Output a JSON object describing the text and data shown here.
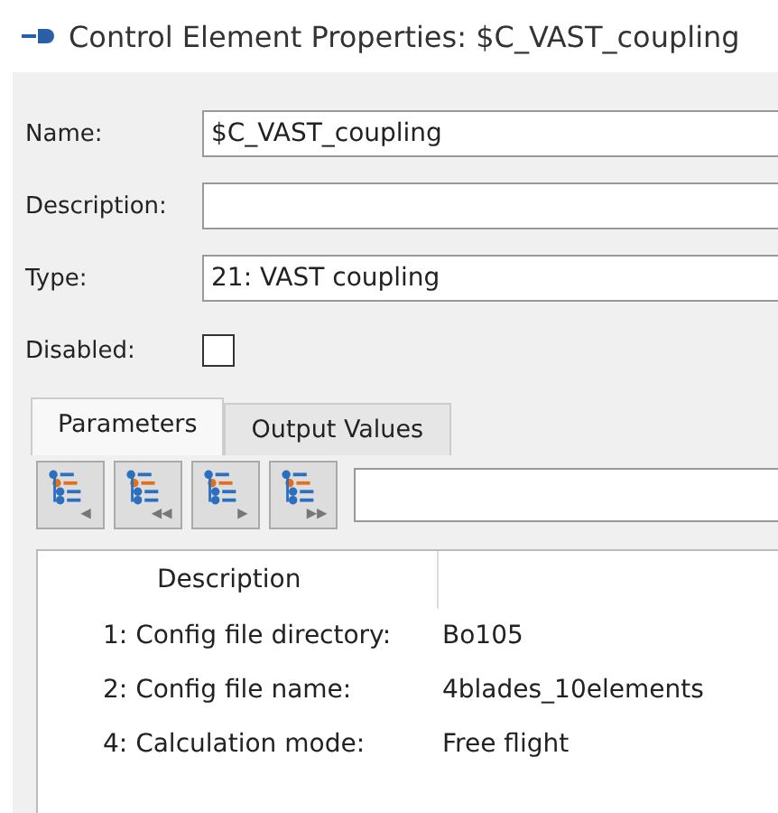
{
  "window": {
    "title": "Control Element Properties: $C_VAST_coupling"
  },
  "fields": [
    {
      "label": "Name:",
      "value": "$C_VAST_coupling"
    },
    {
      "label": "Description:"
    },
    {
      "label": "Type:",
      "value": "21: VAST coupling"
    }
  ],
  "disabled": {
    "label": "Disabled:",
    "checked": false
  },
  "tabs": [
    {
      "label": "Parameters",
      "selected": true
    },
    {
      "label": "Output Values",
      "selected": false
    }
  ],
  "toolbar": {
    "buttons": [
      {
        "kind": "prev"
      },
      {
        "kind": "first"
      },
      {
        "kind": "next"
      },
      {
        "kind": "last"
      }
    ]
  },
  "table": {
    "columns": [
      "Description"
    ],
    "rows": [
      {
        "name": "1: Config file directory:",
        "value": "Bo105"
      },
      {
        "name": "2: Config file name:",
        "value": "4blades_10elements"
      },
      {
        "name": "4: Calculation mode:",
        "value": "Free flight"
      }
    ]
  }
}
